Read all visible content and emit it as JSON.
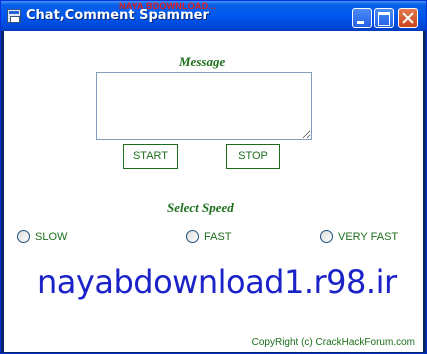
{
  "window": {
    "title": "Chat,Comment Spammer",
    "watermark": "NAYA BDOWNLOAD..."
  },
  "message": {
    "label": "Message",
    "value": ""
  },
  "buttons": {
    "start_label": "START",
    "stop_label": "STOP"
  },
  "speed": {
    "label": "Select Speed",
    "options": [
      {
        "label": "SLOW",
        "selected": false
      },
      {
        "label": "FAST",
        "selected": false
      },
      {
        "label": "VERY FAST",
        "selected": false
      }
    ]
  },
  "overlay_text": "nayabdownload1.r98.ir",
  "footer": {
    "copyright": "CopyRight (c) CrackHackForum.com"
  },
  "colors": {
    "label_green": "#1c6e1c",
    "overlay_blue": "#1a22c8",
    "titlebar_blue": "#0058ee"
  }
}
